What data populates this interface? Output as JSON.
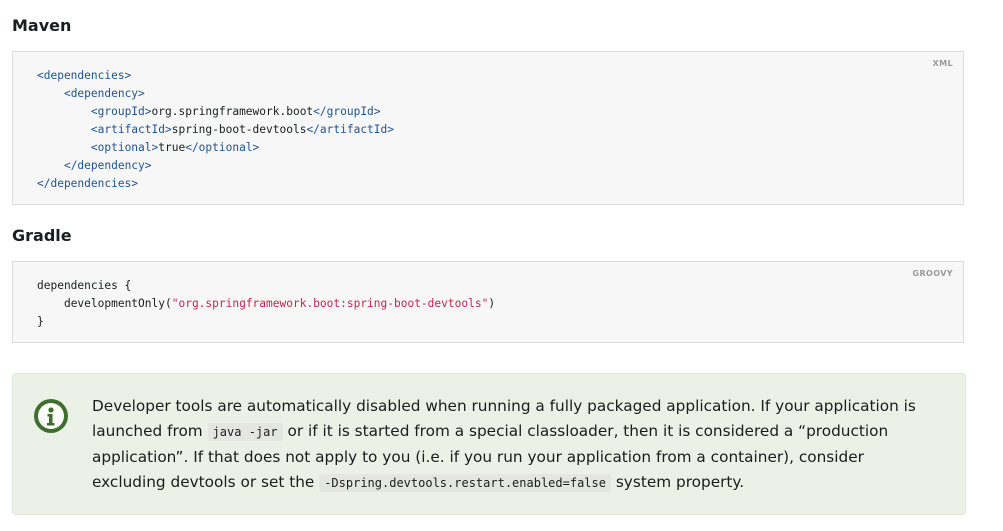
{
  "maven": {
    "heading": "Maven",
    "lang": "XML",
    "lines": [
      {
        "indent": "",
        "open": "<dependencies>",
        "text": "",
        "close": ""
      },
      {
        "indent": "    ",
        "open": "<dependency>",
        "text": "",
        "close": ""
      },
      {
        "indent": "        ",
        "open": "<groupId>",
        "text": "org.springframework.boot",
        "close": "</groupId>"
      },
      {
        "indent": "        ",
        "open": "<artifactId>",
        "text": "spring-boot-devtools",
        "close": "</artifactId>"
      },
      {
        "indent": "        ",
        "open": "<optional>",
        "text": "true",
        "close": "</optional>"
      },
      {
        "indent": "    ",
        "open": "</dependency>",
        "text": "",
        "close": ""
      },
      {
        "indent": "",
        "open": "</dependencies>",
        "text": "",
        "close": ""
      }
    ]
  },
  "gradle": {
    "heading": "Gradle",
    "lang": "GROOVY",
    "line1": "dependencies {",
    "line2_indent": "    ",
    "line2_fn": "developmentOnly(",
    "line2_str": "\"org.springframework.boot:spring-boot-devtools\"",
    "line2_end": ")",
    "line3": "}"
  },
  "note": {
    "icon": "info-icon",
    "text_1": "Developer tools are automatically disabled when running a fully packaged application. If your application is launched from ",
    "code_1": "java -jar",
    "text_2": " or if it is started from a special classloader, then it is considered a “production application”. If that does not apply to you (i.e. if you run your application from a container), consider excluding devtools or set the ",
    "code_2": "-Dspring.devtools.restart.enabled=false",
    "text_3": " system property."
  }
}
